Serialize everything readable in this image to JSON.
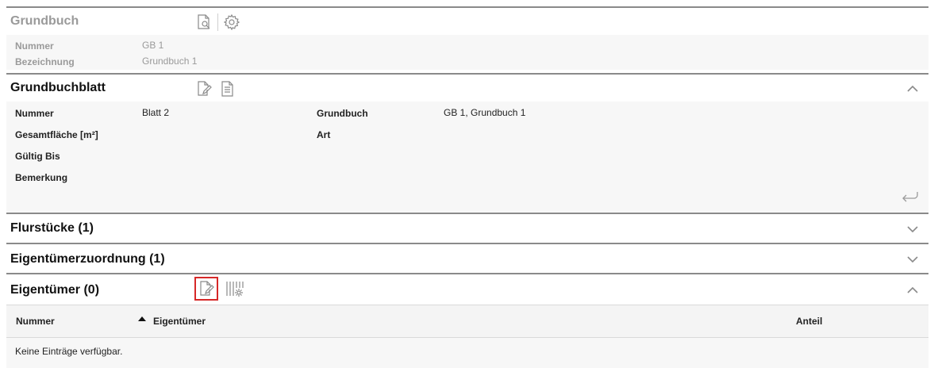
{
  "grundbuch": {
    "title": "Grundbuch",
    "fields": [
      {
        "label": "Nummer",
        "value": "GB 1"
      },
      {
        "label": "Bezeichnung",
        "value": "Grundbuch 1"
      }
    ]
  },
  "grundbuchblatt": {
    "title": "Grundbuchblatt",
    "left": [
      {
        "label": "Nummer",
        "value": "Blatt 2"
      },
      {
        "label": "Gesamtfläche [m²]",
        "value": ""
      },
      {
        "label": "Gültig Bis",
        "value": ""
      },
      {
        "label": "Bemerkung",
        "value": ""
      }
    ],
    "right": [
      {
        "label": "Grundbuch",
        "value": "GB 1, Grundbuch 1"
      },
      {
        "label": "Art",
        "value": ""
      }
    ]
  },
  "flurstuecke": {
    "title": "Flurstücke (1)"
  },
  "eigentuemerzuordnung": {
    "title": "Eigentümerzuordnung (1)"
  },
  "eigentuemer": {
    "title": "Eigentümer (0)",
    "columns": [
      "Nummer",
      "Eigentümer",
      "Anteil"
    ],
    "empty_text": "Keine Einträge verfügbar."
  },
  "icons": {
    "search_doc": "document-search-icon",
    "settings": "gear-icon",
    "edit_doc": "document-edit-icon",
    "doc": "document-icon",
    "columns_config": "columns-settings-icon",
    "back": "return-arrow-icon",
    "collapse": "chevron-up-icon",
    "expand": "chevron-down-icon",
    "sort": "sort-ascending-icon"
  },
  "colors": {
    "accent_selected": "#d62828",
    "section_border": "#8a8a8a",
    "muted_text": "#9a9a9a",
    "body_bg": "#f7f7f7"
  }
}
